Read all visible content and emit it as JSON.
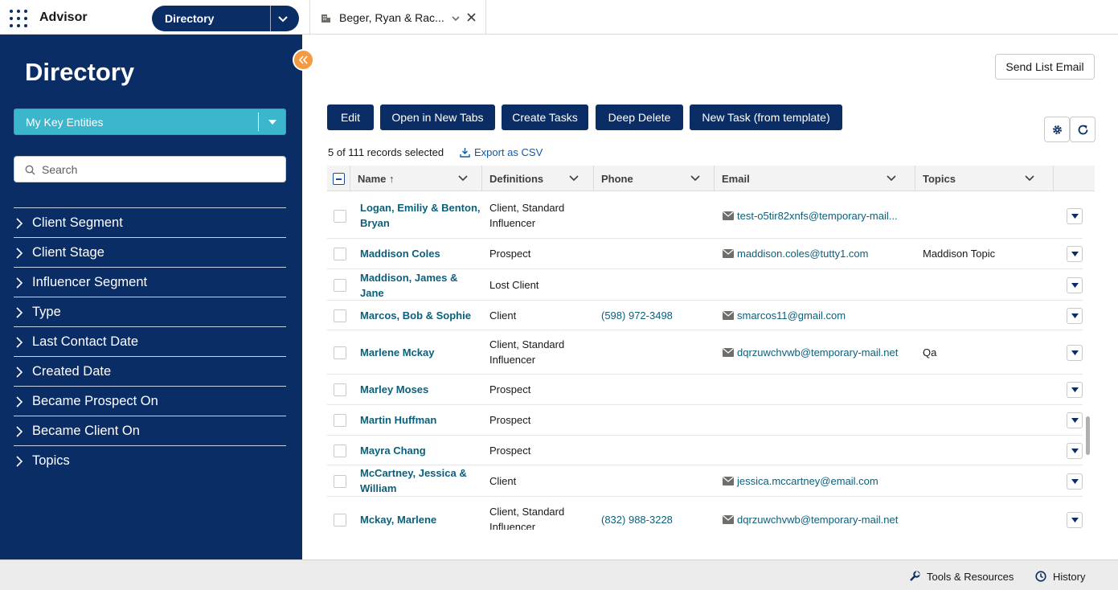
{
  "app": {
    "name": "Advisor",
    "nav_label": "Directory",
    "tab_label": "Beger, Ryan & Rac..."
  },
  "sidebar": {
    "title": "Directory",
    "view_select": "My Key Entities",
    "search_placeholder": "Search",
    "filters": [
      "Client Segment",
      "Client Stage",
      "Influencer Segment",
      "Type",
      "Last Contact Date",
      "Created Date",
      "Became Prospect On",
      "Became Client On",
      "Topics"
    ]
  },
  "main": {
    "send_list_email": "Send List Email",
    "actions": [
      "Edit",
      "Open in New Tabs",
      "Create Tasks",
      "Deep Delete",
      "New Task (from template)"
    ],
    "selection_info": "5 of 111 records selected",
    "export_label": "Export as CSV",
    "columns": [
      "Name",
      "Definitions",
      "Phone",
      "Email",
      "Topics"
    ],
    "sort_indicator": "↑",
    "rows": [
      {
        "name": "Logan, Emiliy & Benton, Bryan",
        "definitions": "Client, Standard Influencer",
        "phone": "",
        "email": "test-o5tir82xnfs@temporary-mail...",
        "topics": ""
      },
      {
        "name": "Maddison Coles",
        "definitions": "Prospect",
        "phone": "",
        "email": "maddison.coles@tutty1.com",
        "topics": "Maddison Topic"
      },
      {
        "name": "Maddison, James & Jane",
        "definitions": "Lost Client",
        "phone": "",
        "email": "",
        "topics": ""
      },
      {
        "name": "Marcos, Bob & Sophie",
        "definitions": "Client",
        "phone": "(598) 972-3498",
        "email": "smarcos11@gmail.com",
        "topics": ""
      },
      {
        "name": "Marlene Mckay",
        "definitions": "Client, Standard Influencer",
        "phone": "",
        "email": "dqrzuwchvwb@temporary-mail.net",
        "topics": "Qa"
      },
      {
        "name": "Marley Moses",
        "definitions": "Prospect",
        "phone": "",
        "email": "",
        "topics": ""
      },
      {
        "name": "Martin Huffman",
        "definitions": "Prospect",
        "phone": "",
        "email": "",
        "topics": ""
      },
      {
        "name": "Mayra Chang",
        "definitions": "Prospect",
        "phone": "",
        "email": "",
        "topics": ""
      },
      {
        "name": "McCartney, Jessica & William",
        "definitions": "Client",
        "phone": "",
        "email": "jessica.mccartney@email.com",
        "topics": ""
      },
      {
        "name": "Mckay, Marlene",
        "definitions": "Client, Standard Influencer",
        "phone": "(832) 988-3228",
        "email": "dqrzuwchvwb@temporary-mail.net",
        "topics": ""
      }
    ]
  },
  "footer": {
    "tools": "Tools & Resources",
    "history": "History"
  },
  "colors": {
    "navy": "#0b2d66",
    "teal": "#3bb6cc",
    "orange": "#f49a42",
    "link": "#0b5f7a"
  }
}
